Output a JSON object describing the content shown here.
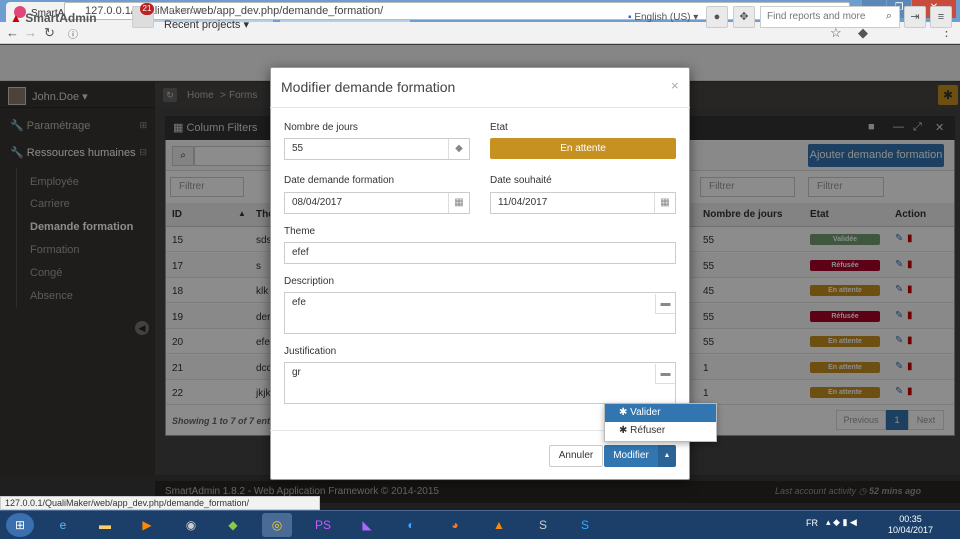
{
  "browser": {
    "tabs": [
      {
        "label": "SmartAdmin",
        "active": true
      },
      {
        "label": "",
        "active": false
      },
      {
        "label": "",
        "active": false
      }
    ],
    "url": "127.0.0.1/QualiMaker/web/app_dev.php/demande_formation/",
    "status_url": "127.0.0.1/QualiMaker/web/app_dev.php/demande_formation/"
  },
  "header": {
    "logo": "SmartAdmin",
    "notification_count": "21",
    "projects_label": "PROJECTS",
    "projects_value": "Recent projects",
    "language": "English (US)",
    "search_placeholder": "Find reports and more"
  },
  "sidebar": {
    "user": "John.Doe",
    "items": [
      {
        "label": "Paramétrage",
        "icon": "wrench-icon"
      },
      {
        "label": "Ressources humaines",
        "icon": "wrench-icon"
      }
    ],
    "subitems": [
      {
        "label": "Employée"
      },
      {
        "label": "Carriere"
      },
      {
        "label": "Demande formation",
        "active": true
      },
      {
        "label": "Formation"
      },
      {
        "label": "Congé"
      },
      {
        "label": "Absence"
      }
    ]
  },
  "breadcrumb": [
    "Home",
    "Forms"
  ],
  "widget": {
    "title": "Column Filters",
    "add_button": "Ajouter demande formation",
    "filter_placeholder": "Filtrer",
    "columns": [
      "ID",
      "Thé",
      "Nombre de jours",
      "Etat",
      "Action"
    ],
    "rows": [
      {
        "id": "15",
        "theme": "sds",
        "jours": "55",
        "etat": "Validée",
        "color": "#739e73"
      },
      {
        "id": "17",
        "theme": "s",
        "jours": "55",
        "etat": "Réfusée",
        "color": "#a90329"
      },
      {
        "id": "18",
        "theme": "klk",
        "jours": "45",
        "etat": "En attente",
        "color": "#c79121"
      },
      {
        "id": "19",
        "theme": "der",
        "jours": "55",
        "etat": "Réfusée",
        "color": "#a90329"
      },
      {
        "id": "20",
        "theme": "efe",
        "jours": "55",
        "etat": "En attente",
        "color": "#c79121"
      },
      {
        "id": "21",
        "theme": "dcc",
        "jours": "1",
        "etat": "En attente",
        "color": "#c79121"
      },
      {
        "id": "22",
        "theme": "jkjk",
        "jours": "1",
        "etat": "En attente",
        "color": "#c79121"
      }
    ],
    "info": "Showing 1 to 7 of 7 ent",
    "pager": {
      "previous": "Previous",
      "page": "1",
      "next": "Next"
    }
  },
  "footer": {
    "version": "SmartAdmin 1.8.2 - Web Application Framework © 2014-2015",
    "last_activity": "Last account activity",
    "last_activity_value": "52 mins ago"
  },
  "modal": {
    "title": "Modifier demande formation",
    "nombre_jours_label": "Nombre de jours",
    "nombre_jours_value": "55",
    "etat_label": "Etat",
    "etat_value": "En attente",
    "date_demande_label": "Date demande formation",
    "date_demande_value": "08/04/2017",
    "date_souhaite_label": "Date souhaité",
    "date_souhaite_value": "11/04/2017",
    "theme_label": "Theme",
    "theme_value": "efef",
    "description_label": "Description",
    "description_value": "efe",
    "justification_label": "Justification",
    "justification_value": "gr",
    "cancel": "Annuler",
    "submit": "Modifier",
    "dropdown": [
      "Valider",
      "Réfuser"
    ]
  },
  "taskbar": {
    "lang": "FR",
    "time": "00:35",
    "date": "10/04/2017"
  }
}
